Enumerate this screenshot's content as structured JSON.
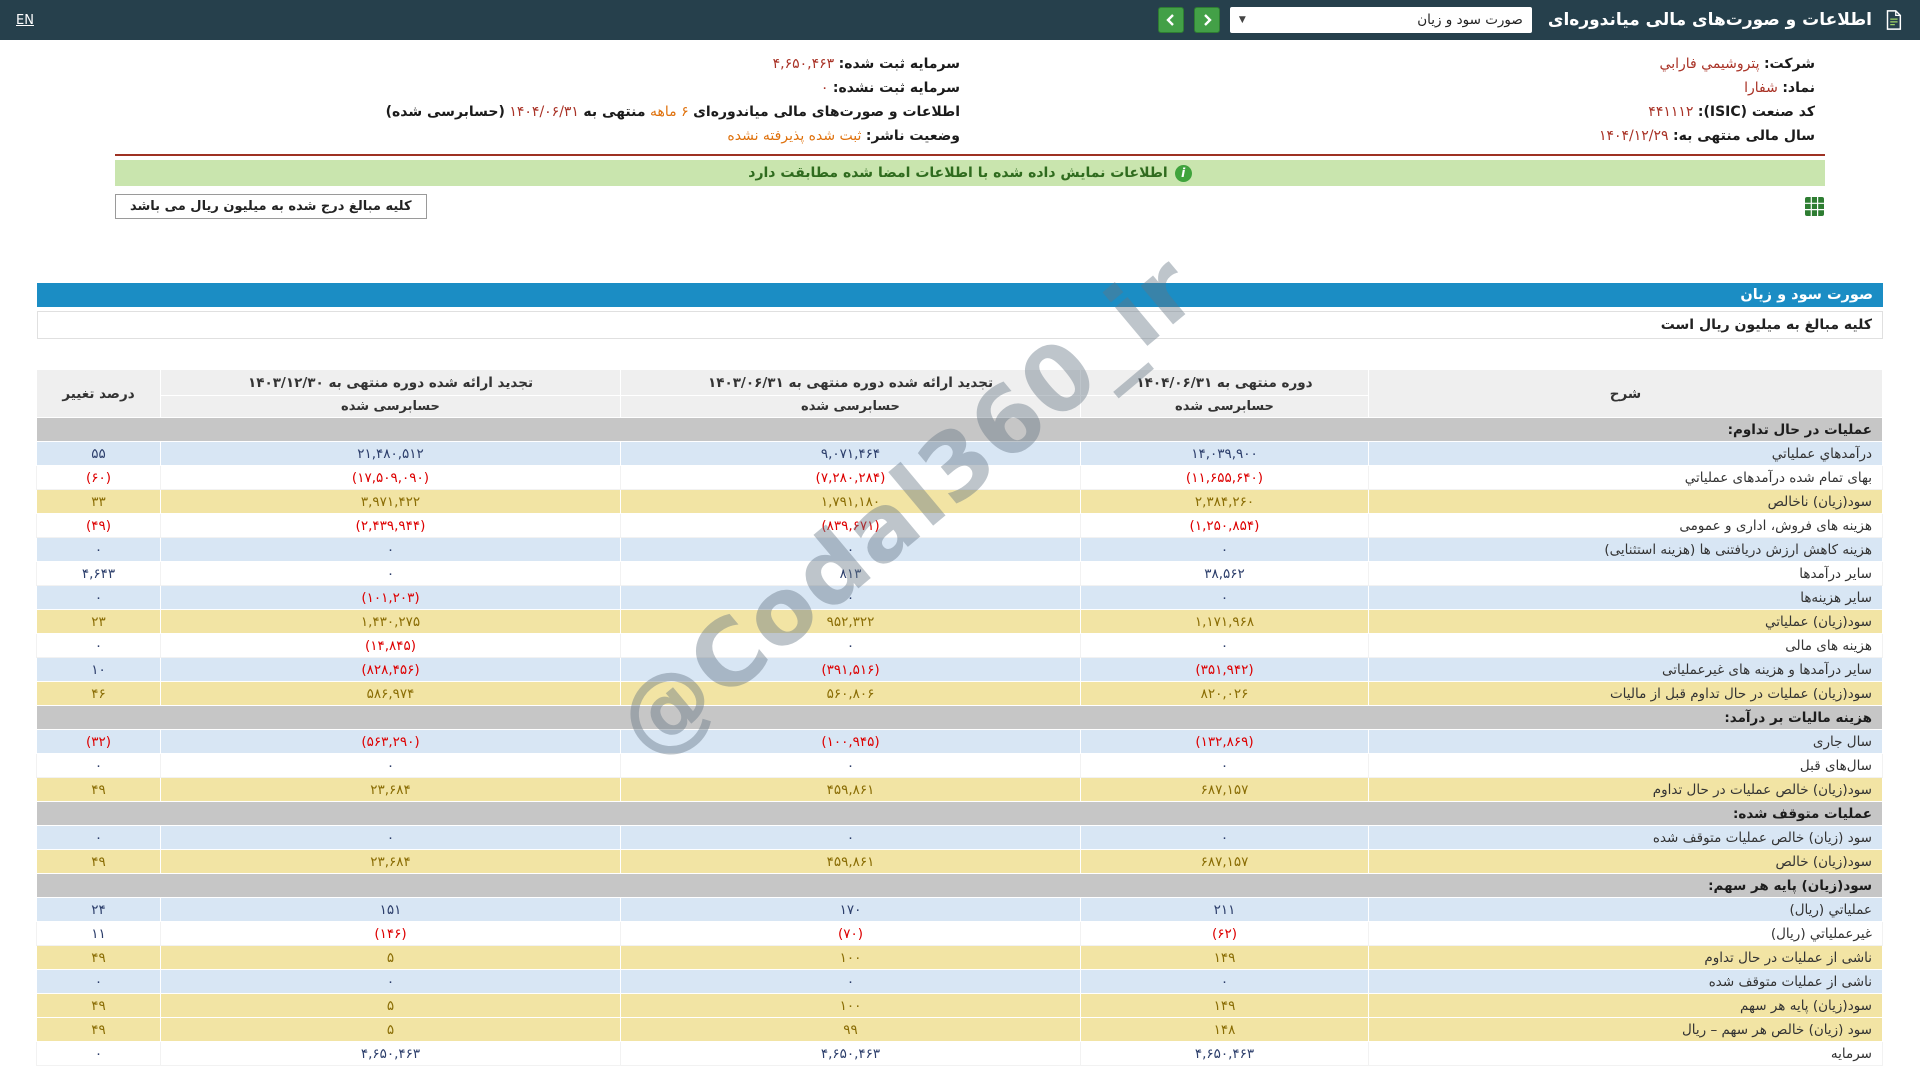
{
  "header": {
    "title": "اطلاعات و صورت‌های مالی میاندوره‌ای",
    "statement_select_value": "صورت سود و زیان",
    "lang": "EN"
  },
  "info": {
    "rows": [
      {
        "right": [
          {
            "t": "شرکت:",
            "c": "lbl"
          },
          {
            "t": "پتروشيمي فارابي",
            "c": "red"
          }
        ],
        "left": [
          {
            "t": "سرمایه ثبت شده:",
            "c": "lbl"
          },
          {
            "t": "۴,۶۵۰,۴۶۳",
            "c": "red"
          }
        ]
      },
      {
        "right": [
          {
            "t": "نماد:",
            "c": "lbl"
          },
          {
            "t": "شفارا",
            "c": "red"
          }
        ],
        "left": [
          {
            "t": "سرمایه ثبت نشده:",
            "c": "lbl"
          },
          {
            "t": "۰",
            "c": "red"
          }
        ]
      },
      {
        "right": [
          {
            "t": "کد صنعت (ISIC):",
            "c": "lbl"
          },
          {
            "t": "۴۴۱۱۱۲",
            "c": "red"
          }
        ],
        "left": [
          {
            "t": "اطلاعات و صورت‌های مالی میاندوره‌ای",
            "c": "lbl"
          },
          {
            "t": "۶ ماهه",
            "c": "orange"
          },
          {
            "t": "منتهی به",
            "c": "lbl"
          },
          {
            "t": "۱۴۰۴/۰۶/۳۱",
            "c": "red"
          },
          {
            "t": "(حسابرسی شده)",
            "c": "lbl"
          }
        ]
      },
      {
        "right": [
          {
            "t": "سال مالی منتهی به:",
            "c": "lbl"
          },
          {
            "t": "۱۴۰۴/۱۲/۲۹",
            "c": "red"
          }
        ],
        "left": [
          {
            "t": "وضعیت ناشر:",
            "c": "lbl"
          },
          {
            "t": "ثبت شده پذیرفته نشده",
            "c": "orange"
          }
        ]
      }
    ],
    "signature_notice": "اطلاعات نمایش داده شده با اطلاعات امضا شده مطابقت دارد",
    "unit_note": "کلیه مبالغ درج شده به میلیون ریال می باشد"
  },
  "statement": {
    "title": "صورت سود و زیان",
    "unit_line": "کلیه مبالغ به میلیون ریال است",
    "columns": {
      "desc": "شرح",
      "change": "درصد تغییر",
      "periods": [
        {
          "title": "دوره منتهی به ۱۴۰۴/۰۶/۳۱",
          "sub": "حسابرسی شده"
        },
        {
          "title": "تجدید ارائه شده دوره منتهی به ۱۴۰۳/۰۶/۳۱",
          "sub": "حسابرسی شده"
        },
        {
          "title": "تجدید ارائه شده دوره منتهی به ۱۴۰۳/۱۲/۳۰",
          "sub": "حسابرسی شده"
        }
      ]
    },
    "rows": [
      {
        "type": "section",
        "desc": "عملیات در حال تداوم:"
      },
      {
        "type": "blue",
        "desc": "درآمدهاي عملياتي",
        "values": [
          "۱۴,۰۳۹,۹۰۰",
          "۹,۰۷۱,۴۶۴",
          "۲۱,۴۸۰,۵۱۲"
        ],
        "change": "۵۵"
      },
      {
        "type": "white",
        "desc": "بهای تمام شده درآمدهای عملياتي",
        "values": [
          "(۱۱,۶۵۵,۶۴۰)",
          "(۷,۲۸۰,۲۸۴)",
          "(۱۷,۵۰۹,۰۹۰)"
        ],
        "change": "(۶۰)"
      },
      {
        "type": "yellow",
        "desc": "سود(زیان) ناخالص",
        "values": [
          "۲,۳۸۴,۲۶۰",
          "۱,۷۹۱,۱۸۰",
          "۳,۹۷۱,۴۲۲"
        ],
        "change": "۳۳"
      },
      {
        "type": "white",
        "desc": "هزینه های فروش، اداری و عمومی",
        "values": [
          "(۱,۲۵۰,۸۵۴)",
          "(۸۳۹,۶۷۱)",
          "(۲,۴۳۹,۹۴۴)"
        ],
        "change": "(۴۹)"
      },
      {
        "type": "blue",
        "desc": "هزینه کاهش ارزش دریافتنی ها (هزینه استثنایی)",
        "values": [
          "۰",
          "۰",
          "۰"
        ],
        "change": "۰"
      },
      {
        "type": "white",
        "desc": "سایر درآمدها",
        "values": [
          "۳۸,۵۶۲",
          "۸۱۳",
          "۰"
        ],
        "change": "۴,۶۴۳"
      },
      {
        "type": "blue",
        "desc": "سایر هزینه‌ها",
        "values": [
          "۰",
          "۰",
          "(۱۰۱,۲۰۳)"
        ],
        "change": "۰"
      },
      {
        "type": "yellow",
        "desc": "سود(زیان) عملياتي",
        "values": [
          "۱,۱۷۱,۹۶۸",
          "۹۵۲,۳۲۲",
          "۱,۴۳۰,۲۷۵"
        ],
        "change": "۲۳"
      },
      {
        "type": "white",
        "desc": "هزینه های مالی",
        "values": [
          "۰",
          "۰",
          "(۱۴,۸۴۵)"
        ],
        "change": "۰"
      },
      {
        "type": "blue",
        "desc": "سایر درآمدها و هزینه های غیرعملیاتی",
        "values": [
          "(۳۵۱,۹۴۲)",
          "(۳۹۱,۵۱۶)",
          "(۸۲۸,۴۵۶)"
        ],
        "change": "۱۰"
      },
      {
        "type": "yellow",
        "desc": "سود(زیان) عملیات در حال تداوم قبل از مالیات",
        "values": [
          "۸۲۰,۰۲۶",
          "۵۶۰,۸۰۶",
          "۵۸۶,۹۷۴"
        ],
        "change": "۴۶"
      },
      {
        "type": "section",
        "desc": "هزینه مالیات بر درآمد:"
      },
      {
        "type": "blue",
        "desc": "سال جاری",
        "values": [
          "(۱۳۲,۸۶۹)",
          "(۱۰۰,۹۴۵)",
          "(۵۶۳,۲۹۰)"
        ],
        "change": "(۳۲)"
      },
      {
        "type": "white",
        "desc": "سال‌های قبل",
        "values": [
          "۰",
          "۰",
          "۰"
        ],
        "change": "۰"
      },
      {
        "type": "yellow",
        "desc": "سود(زیان) خالص عملیات در حال تداوم",
        "values": [
          "۶۸۷,۱۵۷",
          "۴۵۹,۸۶۱",
          "۲۳,۶۸۴"
        ],
        "change": "۴۹"
      },
      {
        "type": "section",
        "desc": "عملیات متوقف شده:"
      },
      {
        "type": "blue",
        "desc": "سود (زیان) خالص عملیات متوقف شده",
        "values": [
          "۰",
          "۰",
          "۰"
        ],
        "change": "۰"
      },
      {
        "type": "yellow",
        "desc": "سود(زیان) خالص",
        "values": [
          "۶۸۷,۱۵۷",
          "۴۵۹,۸۶۱",
          "۲۳,۶۸۴"
        ],
        "change": "۴۹"
      },
      {
        "type": "section",
        "desc": "سود(زیان) پایه هر سهم:"
      },
      {
        "type": "blue",
        "desc": "عملياتي (ریال)",
        "values": [
          "۲۱۱",
          "۱۷۰",
          "۱۵۱"
        ],
        "change": "۲۴"
      },
      {
        "type": "white",
        "desc": "غیرعملياتي (ریال)",
        "values": [
          "(۶۲)",
          "(۷۰)",
          "(۱۴۶)"
        ],
        "change": "۱۱"
      },
      {
        "type": "yellow",
        "desc": "ناشی از عملیات در حال تداوم",
        "values": [
          "۱۴۹",
          "۱۰۰",
          "۵"
        ],
        "change": "۴۹"
      },
      {
        "type": "blue",
        "desc": "ناشی از عملیات متوقف شده",
        "values": [
          "۰",
          "۰",
          "۰"
        ],
        "change": "۰"
      },
      {
        "type": "yellow",
        "desc": "سود(زیان) پایه هر سهم",
        "values": [
          "۱۴۹",
          "۱۰۰",
          "۵"
        ],
        "change": "۴۹"
      },
      {
        "type": "yellow",
        "desc": "سود (زیان) خالص هر سهم – ریال",
        "values": [
          "۱۴۸",
          "۹۹",
          "۵"
        ],
        "change": "۴۹"
      },
      {
        "type": "white",
        "desc": "سرمایه",
        "values": [
          "۴,۶۵۰,۴۶۳",
          "۴,۶۵۰,۴۶۳",
          "۴,۶۵۰,۴۶۳"
        ],
        "change": "۰"
      }
    ]
  },
  "watermark": "@Codal360_ir",
  "colors": {
    "header_dark": "#26404c",
    "accent_blue": "#1b8dc4",
    "row_blue": "#d8e6f4",
    "row_yellow": "#f2e4a4",
    "section_gray": "#c6c6c6",
    "negative_red": "#dd0000",
    "notice_green": "#c9e5ae",
    "button_green": "#43a047"
  }
}
